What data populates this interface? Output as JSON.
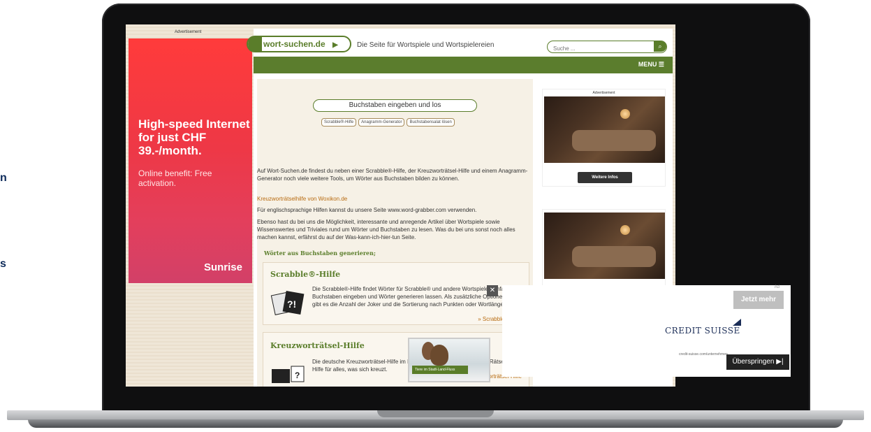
{
  "edge": {
    "text_a": "n",
    "text_b": "s"
  },
  "left_ad": {
    "label": "Advertisement",
    "headline": "High-speed Internet for just CHF 39.-/month.",
    "subtext": "Online benefit: Free activation.",
    "brand": "Sunrise"
  },
  "site": {
    "logo": "wort-suchen.de",
    "tagline": "Die Seite für Wortspiele und Wortspielereien",
    "search_placeholder": "Suche ...",
    "menu_label": "MENU",
    "letters_placeholder": "Buchstaben eingeben und los",
    "pills": [
      "Scrabble®-Hilfe",
      "Anagramm-Generator",
      "Buchstabensalat lösen"
    ],
    "intro": "Auf Wort-Suchen.de findest du neben einer Scrabble®-Hilfe, der Kreuzworträtsel-Hilfe und einem Anagramm-Generator noch viele weitere Tools, um Wörter aus Buchstaben bilden zu können.",
    "woxikon_link": "Kreuzworträtselhilfe von Woxikon.de",
    "english": "Für englischsprachige Hilfen kannst du unsere Seite www.word-grabber.com verwenden.",
    "ebenso": "Ebenso hast du bei uns die Möglichkeit, interessante und anregende Artikel über Wortspiele sowie Wissenswertes und Triviales rund um Wörter und Buchstaben zu lesen. Was du bei uns sonst noch alles machen kannst, erfährst du auf der Was-kann-ich-hier-tun Seite.",
    "section_title": "Wörter aus Buchstaben generieren;",
    "cards": [
      {
        "title": "Scrabble®-Hilfe",
        "desc": "Die Scrabble®-Hilfe findet Wörter für Scrabble® und andere Wortspiele. Einfach Buchstaben eingeben und Wörter generieren lassen. Als zusätzliche Optionen gibt es die Anzahl der Joker und die Sortierung nach Punkten oder Wortlänge.",
        "more": "» Scrabble®-Hilfe"
      },
      {
        "title": "Kreuzworträtsel-Hilfe",
        "desc": "Die deutsche Kreuzworträtsel-Hilfe im Internet. Finde Lösungen mit der Rätsel-Hilfe für alles, was sich kreuzt.",
        "more": "» Kreuzworträtsel-Hilfe"
      }
    ],
    "right_ad_label": "Advertisement",
    "right_ad_cta": "Weitere Infos",
    "squirrel_caption": "Tiere im Stadt-Land-Fluss"
  },
  "overlay": {
    "close": "✕",
    "ad_small": "Ad",
    "cta": "Jetzt mehr",
    "brand": "CREDIT SUISSE",
    "url": "credit-suisse.com/unternehmen",
    "skip": "Überspringen ▶|"
  }
}
